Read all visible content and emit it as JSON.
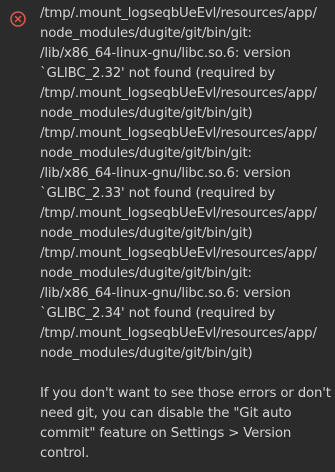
{
  "notification": {
    "type": "error",
    "icon": "error-circle-x-icon",
    "icon_color": "#e0574f",
    "error_lines": [
      "/tmp/.mount_logseqbUeEvl/resources/app/",
      "node_modules/dugite/git/bin/git:",
      "/lib/x86_64-linux-gnu/libc.so.6: version",
      "`GLIBC_2.32' not found (required by",
      "/tmp/.mount_logseqbUeEvl/resources/app/",
      "node_modules/dugite/git/bin/git)",
      "/tmp/.mount_logseqbUeEvl/resources/app/",
      "node_modules/dugite/git/bin/git:",
      "/lib/x86_64-linux-gnu/libc.so.6: version",
      "`GLIBC_2.33' not found (required by",
      "/tmp/.mount_logseqbUeEvl/resources/app/",
      "node_modules/dugite/git/bin/git)",
      "/tmp/.mount_logseqbUeEvl/resources/app/",
      "node_modules/dugite/git/bin/git:",
      "/lib/x86_64-linux-gnu/libc.so.6: version",
      "`GLIBC_2.34' not found (required by",
      "/tmp/.mount_logseqbUeEvl/resources/app/",
      "node_modules/dugite/git/bin/git)"
    ],
    "hint_lines": [
      "If you don't want to see those errors or don't",
      "need git, you can disable the \"Git auto",
      "commit\" feature on Settings > Version",
      "control."
    ]
  }
}
